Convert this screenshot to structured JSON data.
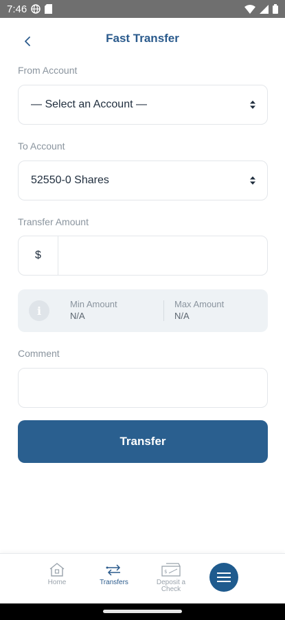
{
  "status_bar": {
    "time": "7:46",
    "icons": [
      "globe-icon",
      "sim-icon",
      "wifi-icon",
      "signal-icon",
      "battery-icon"
    ]
  },
  "header": {
    "title": "Fast Transfer",
    "back_icon": "chevron-left-icon"
  },
  "form": {
    "from_account": {
      "label": "From Account",
      "selected": "— Select an Account —"
    },
    "to_account": {
      "label": "To Account",
      "selected": "52550-0 Shares"
    },
    "transfer_amount": {
      "label": "Transfer Amount",
      "currency_symbol": "$",
      "value": ""
    },
    "limits": {
      "min_label": "Min Amount",
      "min_value": "N/A",
      "max_label": "Max Amount",
      "max_value": "N/A"
    },
    "comment": {
      "label": "Comment",
      "value": ""
    },
    "submit_label": "Transfer"
  },
  "bottom_nav": {
    "items": [
      {
        "label": "Home",
        "icon": "home-icon",
        "active": false
      },
      {
        "label": "Transfers",
        "icon": "transfer-arrows-icon",
        "active": true
      },
      {
        "label": "Deposit a Check",
        "icon": "check-deposit-icon",
        "active": false
      }
    ],
    "menu_icon": "hamburger-icon"
  },
  "colors": {
    "accent": "#2a5f8f",
    "title": "#2a5a8c",
    "label": "#8a949e",
    "info_bg": "#eef2f5"
  }
}
